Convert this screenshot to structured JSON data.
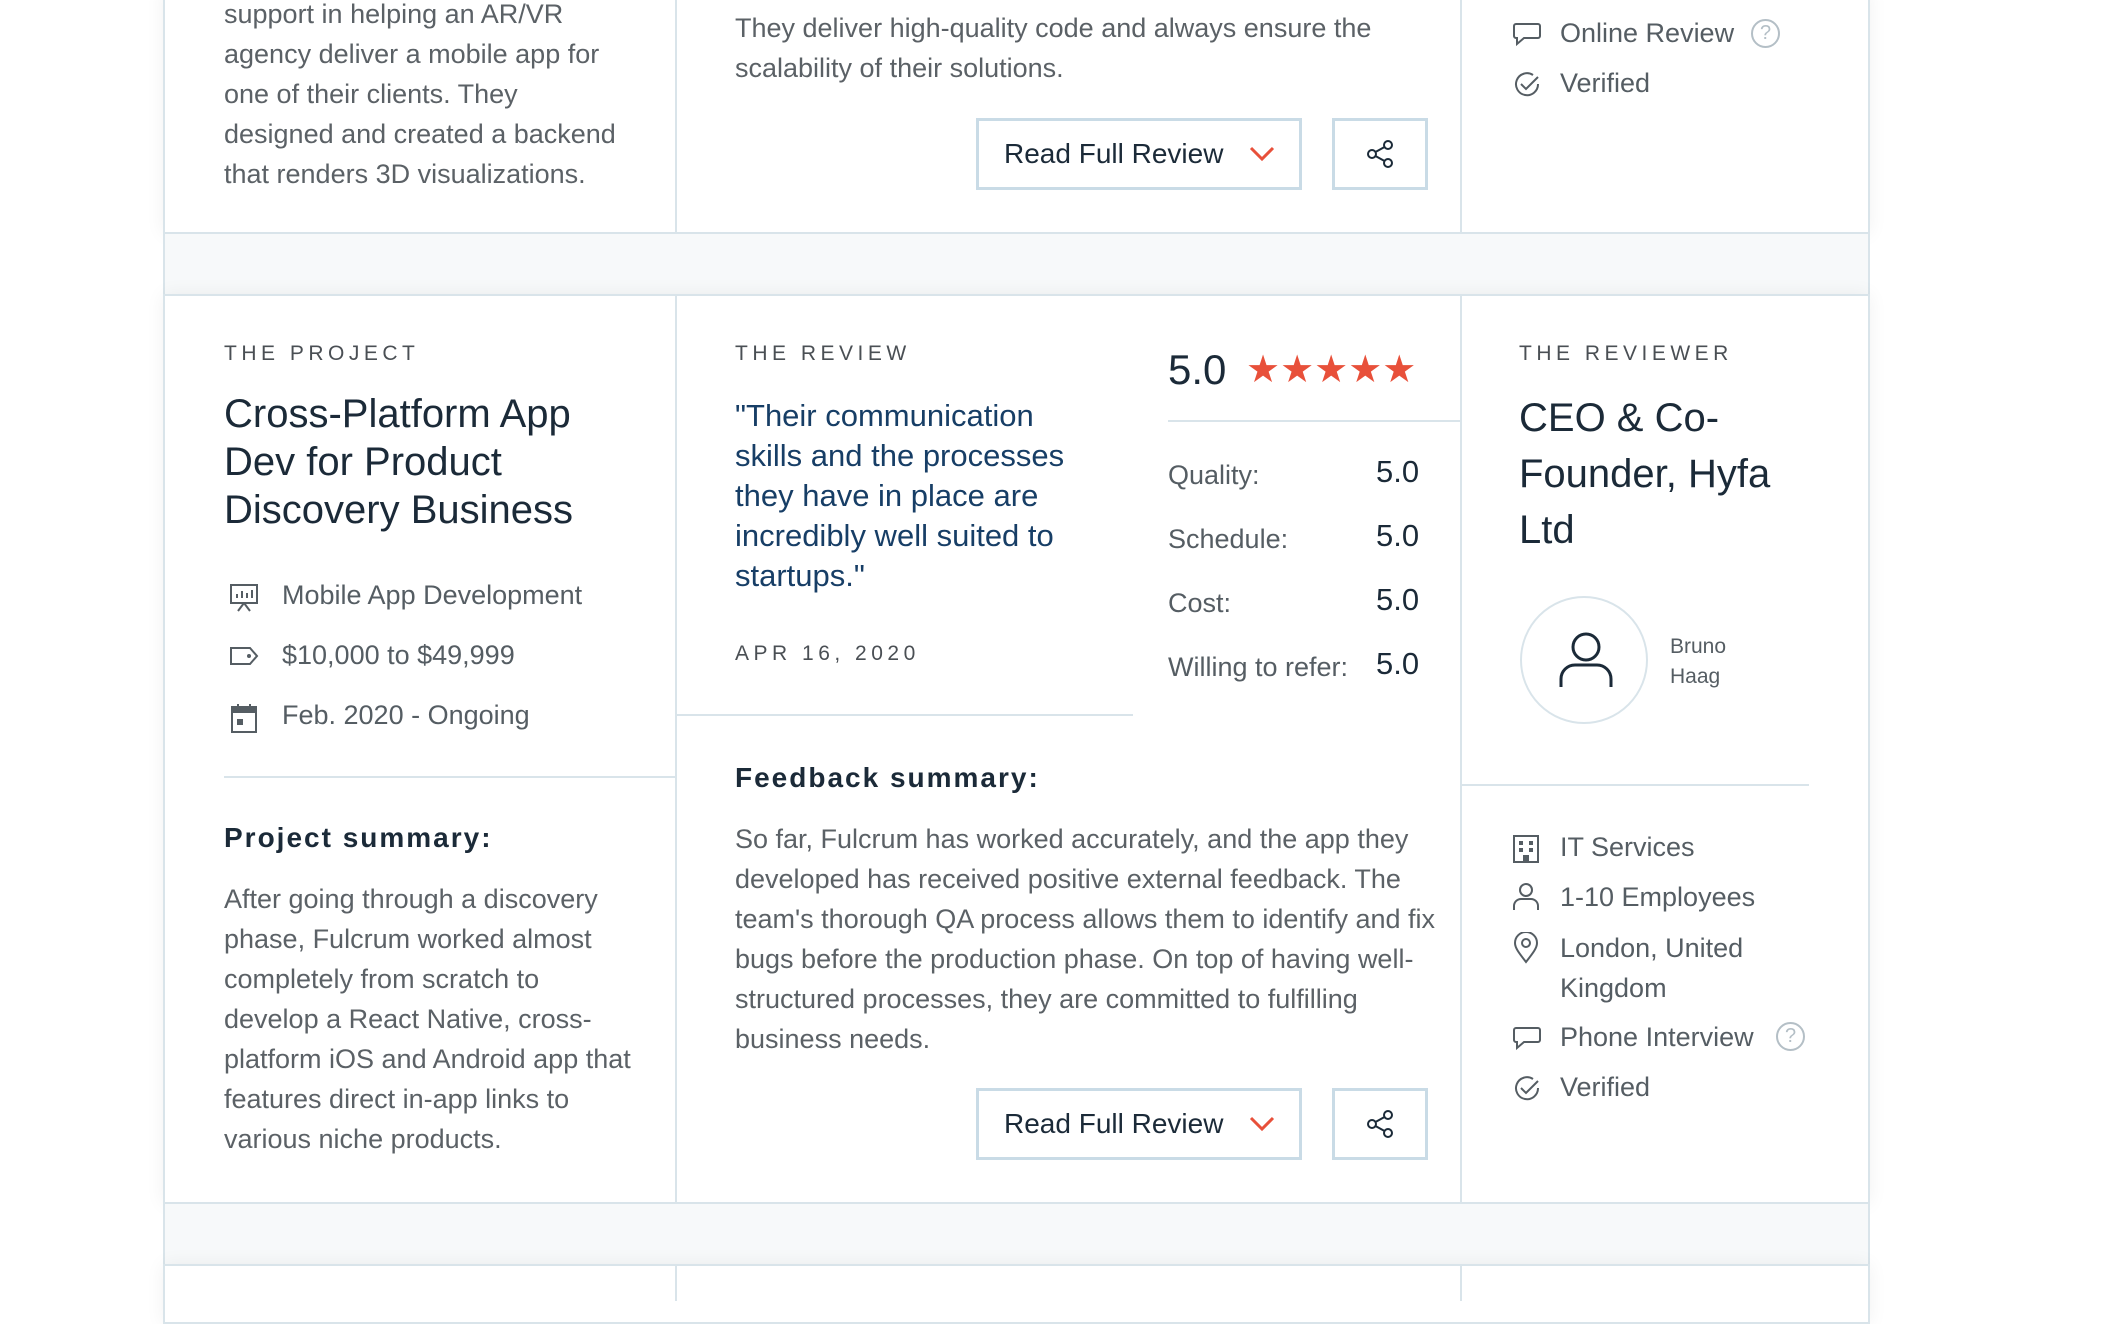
{
  "top_card": {
    "project_summary_tail": "support in helping an AR/VR agency deliver a mobile app for one of their clients. They designed and created a backend that renders 3D visualizations.",
    "feedback_tail": "They deliver high-quality code and always ensure the scalability of their solutions.",
    "read_full_review": "Read Full Review",
    "reviewer_meta": [
      {
        "icon": "chat-bubble-icon",
        "text": "Online Review",
        "help": "?"
      },
      {
        "icon": "check-circle-icon",
        "text": "Verified"
      }
    ]
  },
  "review_card": {
    "project": {
      "eyebrow": "THE PROJECT",
      "title": "Cross-Platform App Dev for Product Discovery Business",
      "meta": [
        {
          "icon": "presentation-icon",
          "text": "Mobile App Development"
        },
        {
          "icon": "price-tag-icon",
          "text": "$10,000 to $49,999"
        },
        {
          "icon": "calendar-icon",
          "text": "Feb. 2020 - Ongoing"
        }
      ],
      "summary_heading": "Project summary:",
      "summary_text": "After going through a discovery phase, Fulcrum worked almost completely from scratch to develop a React Native, cross-platform iOS and Android app that features direct in-app links to various niche products."
    },
    "review": {
      "eyebrow": "THE REVIEW",
      "quote": "\"Their communication skills and the processes they have in place are incredibly well suited to startups.\"",
      "date": "APR 16, 2020",
      "overall_score": "5.0",
      "stars": "★★★★★",
      "scores": [
        {
          "label": "Quality:",
          "value": "5.0"
        },
        {
          "label": "Schedule:",
          "value": "5.0"
        },
        {
          "label": "Cost:",
          "value": "5.0"
        },
        {
          "label": "Willing to refer:",
          "value": "5.0"
        }
      ],
      "feedback_heading": "Feedback summary:",
      "feedback_text": "So far, Fulcrum has worked accurately, and the app they developed has received positive external feedback. The team's thorough QA process allows them to identify and fix bugs before the production phase. On top of having well-structured processes, they are committed to fulfilling business needs.",
      "read_full_review": "Read Full Review"
    },
    "reviewer": {
      "eyebrow": "THE REVIEWER",
      "title": "CEO & Co-Founder, Hyfa Ltd",
      "name": "Bruno Haag",
      "meta": [
        {
          "icon": "building-icon",
          "text": "IT Services"
        },
        {
          "icon": "person-icon",
          "text": "1-10 Employees"
        },
        {
          "icon": "location-pin-icon",
          "text": "London, United Kingdom"
        },
        {
          "icon": "chat-bubble-icon",
          "text": "Phone Interview",
          "help": "?"
        },
        {
          "icon": "check-circle-icon",
          "text": "Verified"
        }
      ]
    }
  },
  "colors": {
    "star": "#e8503a",
    "quote": "#173e66",
    "border": "#d9e4ea",
    "button_border": "#c9dbe6"
  }
}
